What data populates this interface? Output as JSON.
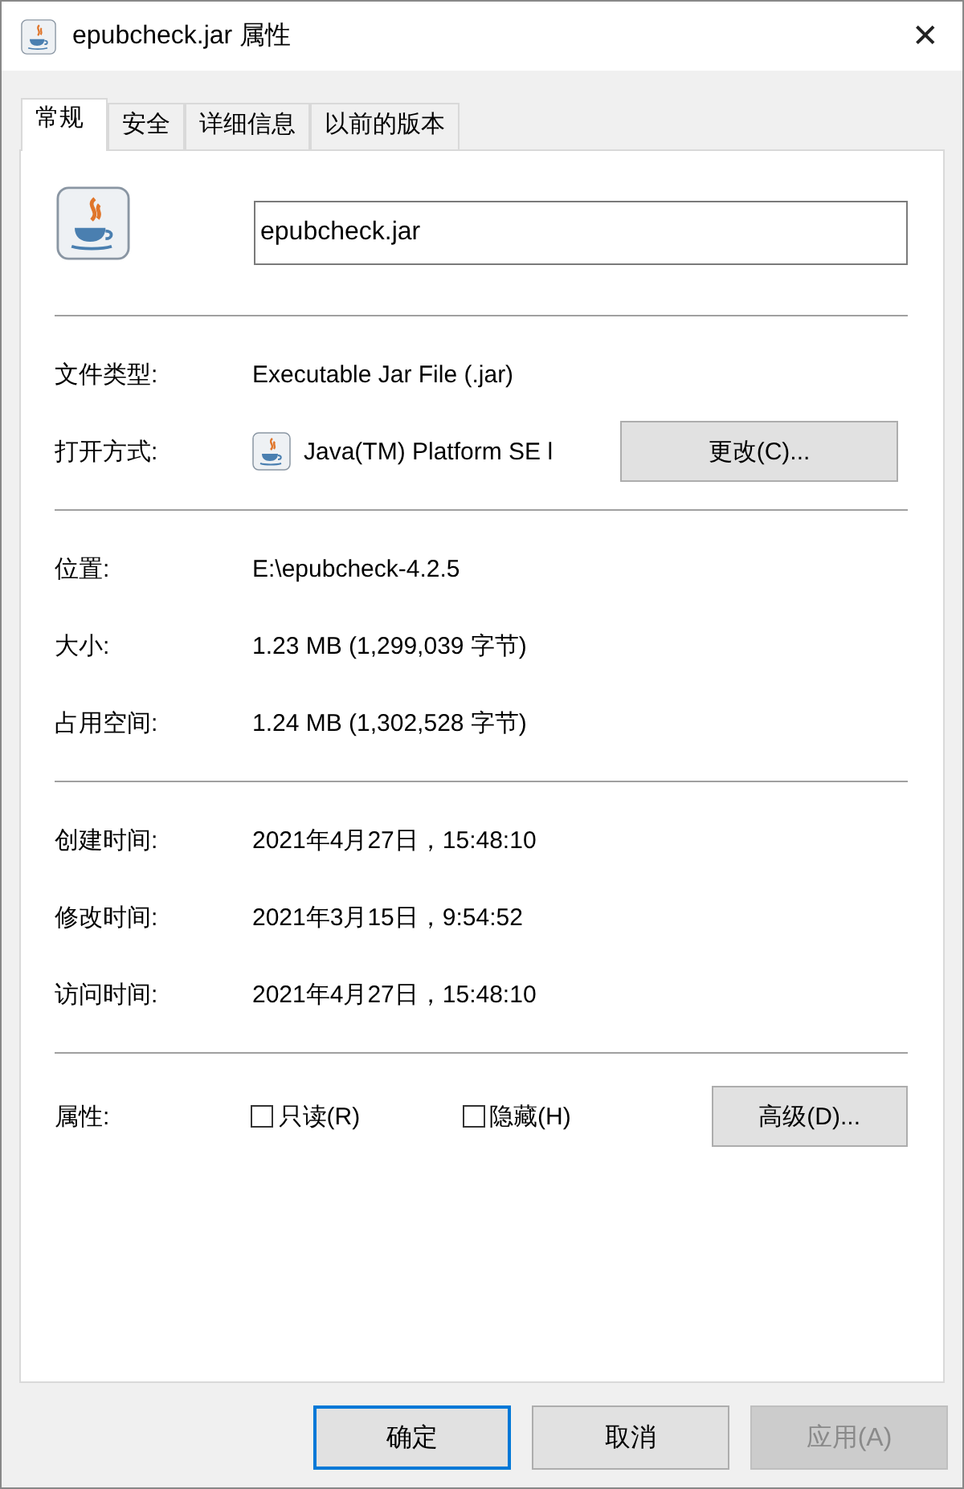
{
  "window": {
    "title": "epubcheck.jar 属性",
    "close": "✕"
  },
  "tabs": [
    {
      "label": "常规",
      "selected": true
    },
    {
      "label": "安全",
      "selected": false
    },
    {
      "label": "详细信息",
      "selected": false
    },
    {
      "label": "以前的版本",
      "selected": false
    }
  ],
  "file_name": {
    "value": "epubcheck.jar"
  },
  "sections": [
    [
      {
        "kind": "text",
        "label": "文件类型:",
        "value": "Executable Jar File (.jar)"
      },
      {
        "kind": "open_with",
        "label": "打开方式:",
        "value": "Java(TM) Platform SE l",
        "button": "更改(C)..."
      }
    ],
    [
      {
        "kind": "text",
        "label": "位置:",
        "value": "E:\\epubcheck-4.2.5"
      },
      {
        "kind": "text",
        "label": "大小:",
        "value": "1.23 MB (1,299,039 字节)"
      },
      {
        "kind": "text",
        "label": "占用空间:",
        "value": "1.24 MB (1,302,528 字节)"
      }
    ],
    [
      {
        "kind": "text",
        "label": "创建时间:",
        "value": "2021年4月27日，15:48:10"
      },
      {
        "kind": "text",
        "label": "修改时间:",
        "value": "2021年3月15日，9:54:52"
      },
      {
        "kind": "text",
        "label": "访问时间:",
        "value": "2021年4月27日，15:48:10"
      }
    ]
  ],
  "attributes": {
    "label": "属性:",
    "options": [
      {
        "label": "只读(R)",
        "checked": false
      },
      {
        "label": "隐藏(H)",
        "checked": false
      }
    ],
    "button": "高级(D)..."
  },
  "buttons": [
    {
      "label": "确定",
      "default": true,
      "disabled": false
    },
    {
      "label": "取消",
      "default": false,
      "disabled": false
    },
    {
      "label": "应用(A)",
      "default": false,
      "disabled": true
    }
  ]
}
